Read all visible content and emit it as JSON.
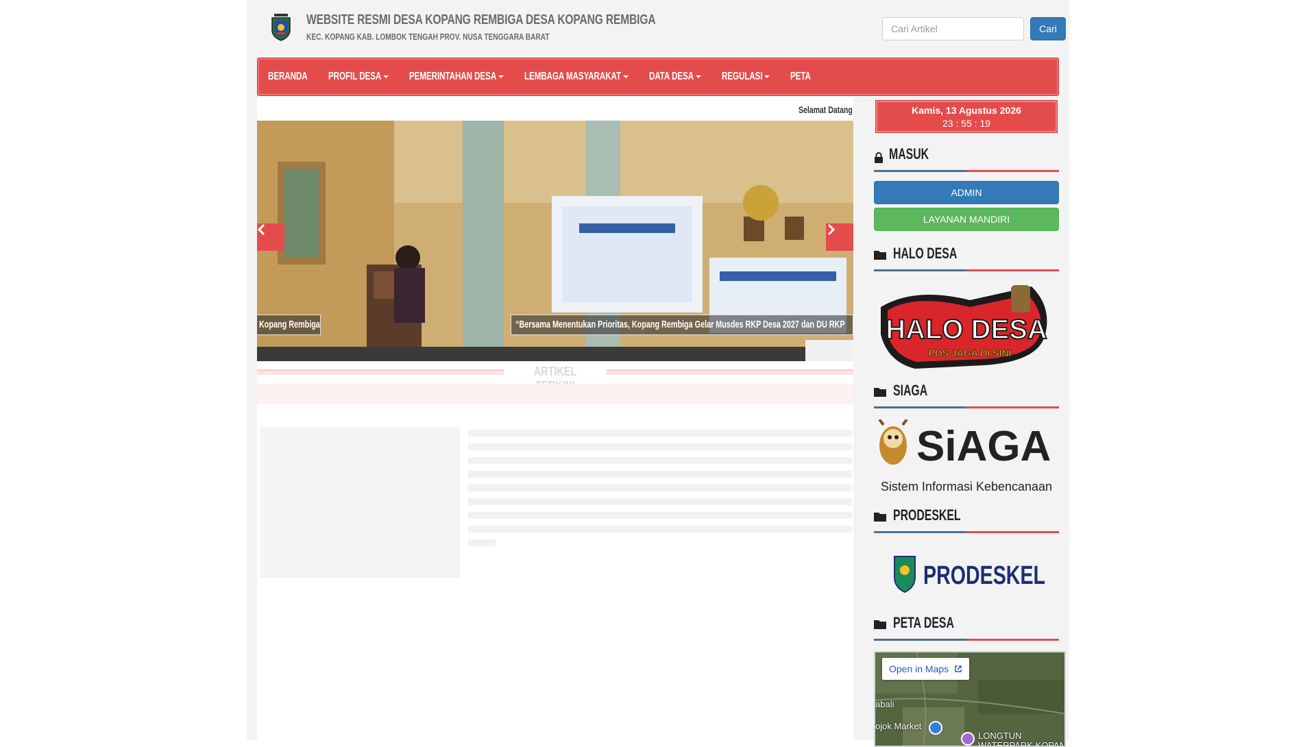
{
  "header": {
    "title": "WEBSITE RESMI DESA KOPANG REMBIGA DESA KOPANG REMBIGA",
    "subtitle": "KEC. KOPANG KAB. LOMBOK TENGAH PROV. NUSA TENGGARA BARAT",
    "search_placeholder": "Cari Artikel",
    "search_button": "Cari"
  },
  "nav": {
    "items": [
      {
        "label": "BERANDA",
        "dropdown": false
      },
      {
        "label": "PROFIL DESA",
        "dropdown": true
      },
      {
        "label": "PEMERINTAHAN DESA",
        "dropdown": true
      },
      {
        "label": "LEMBAGA MASYARAKAT",
        "dropdown": true
      },
      {
        "label": "DATA DESA",
        "dropdown": true
      },
      {
        "label": "REGULASI",
        "dropdown": true
      },
      {
        "label": "PETA",
        "dropdown": false
      }
    ]
  },
  "main": {
    "marquee": "Selamat Datang",
    "slider": {
      "caption_left": "Kopang Rembiga",
      "caption_main": "“Bersama Menentukan Prioritas, Kopang Rembiga Gelar Musdes RKP Desa 2027 dan DU RKP"
    },
    "section_title": "ARTIKEL TERKINI"
  },
  "sidebar": {
    "clock": {
      "date": "Kamis, 13 Agustus 2026",
      "time": "23 : 55 : 19"
    },
    "login_title": "MASUK",
    "admin_button": "ADMIN",
    "layanan_button": "LAYANAN MANDIRI",
    "halo_title": "HALO DESA",
    "halo_logo_text": "HALO DESA",
    "halo_logo_sub": "POS JAGA DI SINI",
    "siaga_title": "SIAGA",
    "siaga_logo_text": "SiAGA",
    "siaga_caption": "Sistem Informasi Kebencanaan",
    "prodeskel_title": "PRODESKEL",
    "prodeskel_logo_text": "PRODESKEL",
    "peta_title": "PETA DESA",
    "map": {
      "open_label": "Open in Maps",
      "label_1": "abali",
      "label_2": "ojok Market",
      "label_3": "LONGTUN",
      "label_4": "WATERPARK KOPAN"
    }
  },
  "colors": {
    "accent_red": "#e44c4c",
    "primary_blue": "#337ab7",
    "success_green": "#5cb85c"
  }
}
